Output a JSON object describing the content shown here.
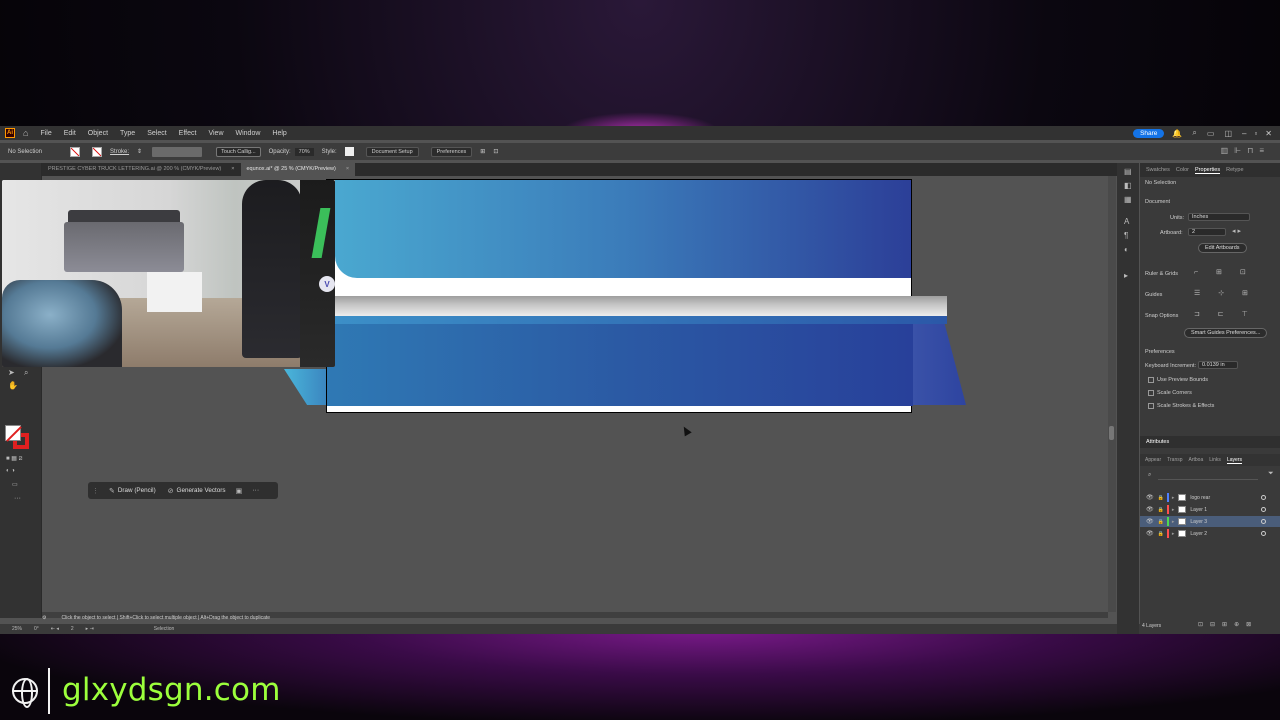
{
  "menubar": {
    "app_logo": "Ai",
    "items": [
      "File",
      "Edit",
      "Object",
      "Type",
      "Select",
      "Effect",
      "View",
      "Window",
      "Help"
    ],
    "share_label": "Share"
  },
  "control_bar": {
    "selection_status": "No Selection",
    "stroke_label": "Stroke:",
    "brush": "Touch Callig...",
    "opacity_label": "Opacity:",
    "opacity_value": "70%",
    "style_label": "Style:",
    "document_setup": "Document Setup",
    "preferences": "Preferences"
  },
  "tabs": [
    {
      "label": "PRESTIGE CYBER TRUCK LETTERING.ai @ 200 % (CMYK/Preview)",
      "close": "×"
    },
    {
      "label": "equnox.ai* @ 25 % (CMYK/Preview)",
      "close": "×"
    }
  ],
  "task_bar": {
    "draw_label": "Draw (Pencil)",
    "generate_label": "Generate Vectors",
    "more": "···"
  },
  "status_hint": "Click the object to select  |  Shift+Click to select multiple object  |  Alt+Drag the object to duplicate",
  "bottom_bar": {
    "zoom": "25%",
    "rotation": "0°",
    "artboard": "2",
    "mode": "Selection"
  },
  "right_panel": {
    "tabs": [
      "Swatches",
      "Color",
      "Properties",
      "Retype"
    ],
    "active_tab": "Properties",
    "no_selection": "No Selection",
    "document_label": "Document",
    "units_label": "Units:",
    "units_value": "Inches",
    "artboard_label": "Artboard:",
    "artboard_value": "2",
    "edit_artboards": "Edit Artboards",
    "ruler_grids": "Ruler & Grids",
    "guides": "Guides",
    "snap_options": "Snap Options",
    "smart_guides": "Smart Guides Preferences...",
    "preferences_label": "Preferences",
    "keyboard_increment_label": "Keyboard Increment:",
    "keyboard_increment_value": "0.0139 in",
    "checkboxes": [
      "Use Preview Bounds",
      "Scale Corners",
      "Scale Strokes & Effects"
    ],
    "attributes_label": "Attributes",
    "layer_tabs": [
      "Appear",
      "Transp",
      "Artboa",
      "Links",
      "Layers"
    ],
    "layers": [
      {
        "name": "logo rear",
        "color": "#4f7fff"
      },
      {
        "name": "Layer 1",
        "color": "#ff4f4f"
      },
      {
        "name": "Layer 3",
        "color": "#4fd94f"
      },
      {
        "name": "Layer 2",
        "color": "#ff4f4f"
      }
    ],
    "layers_count": "4 Layers"
  },
  "webcam": {
    "logo": "V"
  },
  "watermark": {
    "text": "glxydsgn.com"
  },
  "colors": {
    "accent": "#1473e6",
    "watermark": "#9cff3c",
    "artwork_light_blue": "#4aa8d0",
    "artwork_dark_blue": "#2c3f98"
  }
}
